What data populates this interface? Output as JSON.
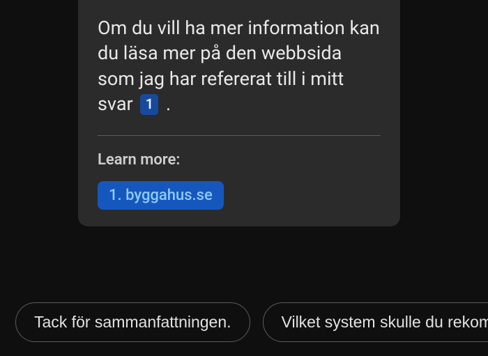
{
  "message": {
    "text_before_citation": "Om du vill ha mer information kan du läsa mer på den webbsida som jag har refererat till i mitt svar ",
    "citation_label": "1",
    "text_after_citation": " ."
  },
  "sources": {
    "label": "Learn more:",
    "items": [
      {
        "label": "1. byggahus.se"
      }
    ]
  },
  "suggestions": [
    {
      "label": "Tack för sammanfattningen."
    },
    {
      "label": "Vilket system skulle du rekomm"
    }
  ]
}
